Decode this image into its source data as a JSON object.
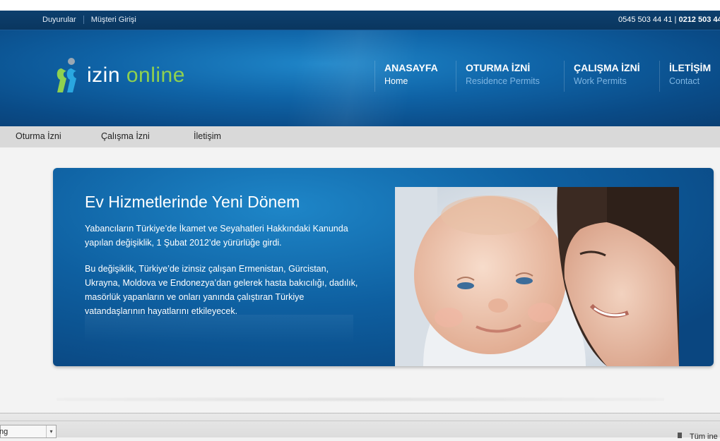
{
  "topbar": {
    "links": [
      "Duyurular",
      "Müşteri Girişi"
    ],
    "phone1": "0545 503 44 41",
    "separator": "|",
    "phone2": "0212 503 44"
  },
  "logo": {
    "word1": "izin",
    "word2": "online",
    "icon": "izin-online-logo-icon"
  },
  "nav": [
    {
      "title": "ANASAYFA",
      "subtitle": "Home"
    },
    {
      "title": "OTURMA İZNİ",
      "subtitle": "Residence Permits"
    },
    {
      "title": "ÇALIŞMA İZNİ",
      "subtitle": "Work Permits"
    },
    {
      "title": "İLETİŞİM",
      "subtitle": "Contact"
    }
  ],
  "subnav": [
    "Oturma İzni",
    "Çalışma İzni",
    "İletişim"
  ],
  "banner": {
    "title": "Ev Hizmetlerinde Yeni Dönem",
    "paragraph1": "Yabancıların Türkiye’de İkamet ve Seyahatleri Hakkındaki Kanunda yapılan değişiklik, 1 Şubat 2012’de yürürlüğe girdi.",
    "paragraph2": "Bu değişiklik, Türkiye’de izinsiz çalışan Ermenistan, Gürcistan, Ukrayna, Moldova ve Endonezya’dan gelerek hasta bakıcılığı, dadılık, masörlük yapanların ve onları yanında çalıştıran Türkiye vatandaşlarının hayatlarını etkileyecek.",
    "image": "mother-and-baby-photo"
  },
  "statusbar": {
    "combo_value": "ng",
    "right_text": "Tüm ine"
  },
  "colors": {
    "header_blue": "#0f63a6",
    "topbar_navy": "#0c3f6e",
    "logo_green": "#8fd14f",
    "nav_subtitle": "#7fb6e3"
  }
}
